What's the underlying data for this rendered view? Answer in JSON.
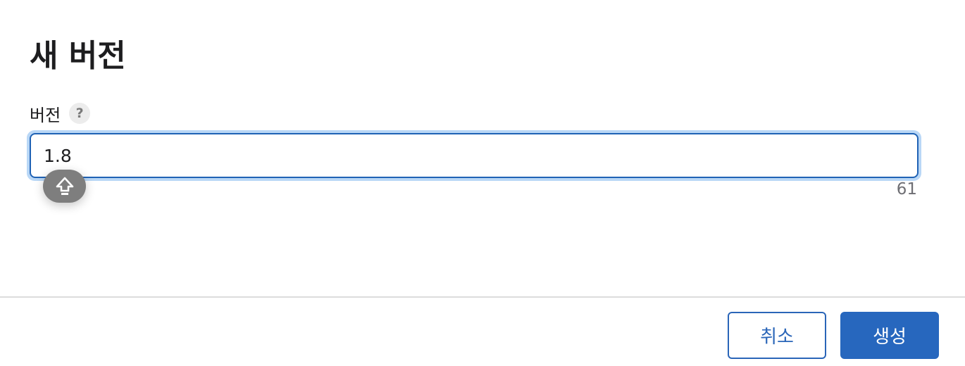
{
  "dialog": {
    "title": "새 버전"
  },
  "field": {
    "label": "버전",
    "help_glyph": "?",
    "value": "1.8",
    "char_remaining": "61"
  },
  "caps_lock_indicator": {
    "icon": "caps-lock-icon",
    "color": "#7e7e7e"
  },
  "footer": {
    "cancel_label": "취소",
    "create_label": "생성"
  },
  "colors": {
    "accent": "#2767be",
    "focus_ring": "#b9d7f6"
  }
}
